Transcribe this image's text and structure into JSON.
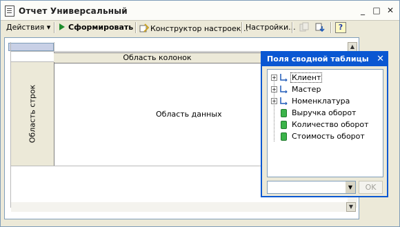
{
  "window": {
    "title": "Отчет  Универсальный",
    "minimize_label": "_",
    "maximize_label": "□",
    "close_label": "✕"
  },
  "toolbar": {
    "actions_label": "Действия",
    "actions_arrow": "▾",
    "generate_label": "Сформировать",
    "constructor_label": "Конструктор настроек...",
    "settings_label": "Настройки...",
    "help_label": "?"
  },
  "grid": {
    "column_area_label": "Область колонок",
    "row_area_label": "Область строк",
    "data_area_label": "Область данных"
  },
  "pivot_panel": {
    "title": "Поля сводной таблицы",
    "close_label": "✕",
    "fields": [
      {
        "label": "Клиент",
        "kind": "dimension",
        "expandable": true,
        "selected": true
      },
      {
        "label": "Мастер",
        "kind": "dimension",
        "expandable": true,
        "selected": false
      },
      {
        "label": "Номенклатура",
        "kind": "dimension",
        "expandable": true,
        "selected": false
      },
      {
        "label": "Выручка оборот",
        "kind": "resource",
        "expandable": false,
        "selected": false
      },
      {
        "label": "Количество оборот",
        "kind": "resource",
        "expandable": false,
        "selected": false
      },
      {
        "label": "Стоимость оборот",
        "kind": "resource",
        "expandable": false,
        "selected": false
      }
    ],
    "area_select_value": "",
    "ok_label": "OK"
  },
  "colors": {
    "accent": "#0a57d2",
    "window_bg": "#ece9d8",
    "resource_icon": "#3bb34a"
  }
}
